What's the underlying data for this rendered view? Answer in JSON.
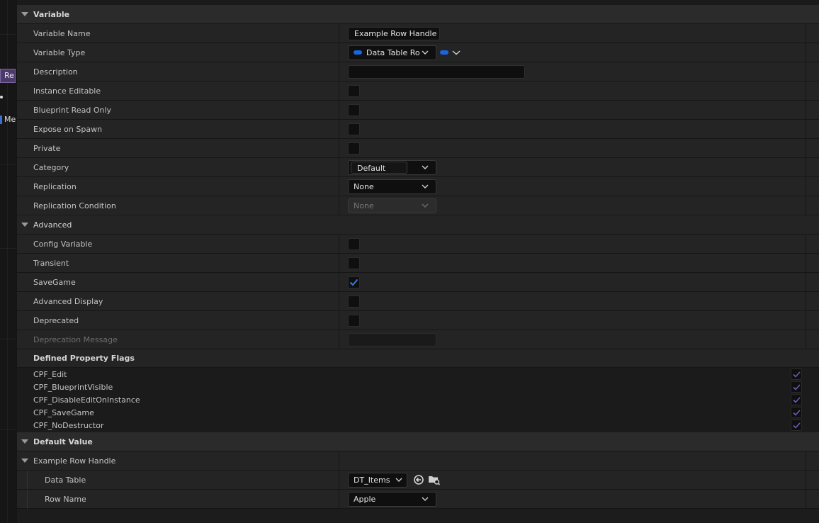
{
  "graph": {
    "node_re_label": "Re",
    "node_me_label": "Me"
  },
  "variable_section": {
    "title": "Variable",
    "variable_name": {
      "label": "Variable Name",
      "value": "Example Row Handle"
    },
    "variable_type": {
      "label": "Variable Type",
      "value": "Data Table Ro",
      "color": "#1a66e0"
    },
    "description": {
      "label": "Description",
      "value": ""
    },
    "instance_editable": {
      "label": "Instance Editable",
      "checked": false
    },
    "blueprint_read_only": {
      "label": "Blueprint Read Only",
      "checked": false
    },
    "expose_on_spawn": {
      "label": "Expose on Spawn",
      "checked": false
    },
    "private": {
      "label": "Private",
      "checked": false
    },
    "category": {
      "label": "Category",
      "value": "Default"
    },
    "replication": {
      "label": "Replication",
      "value": "None"
    },
    "replication_condition": {
      "label": "Replication Condition",
      "value": "None"
    }
  },
  "advanced_section": {
    "title": "Advanced",
    "config_variable": {
      "label": "Config Variable",
      "checked": false
    },
    "transient": {
      "label": "Transient",
      "checked": false
    },
    "save_game": {
      "label": "SaveGame",
      "checked": true
    },
    "advanced_display": {
      "label": "Advanced Display",
      "checked": false
    },
    "deprecated": {
      "label": "Deprecated",
      "checked": false
    },
    "deprecation_message": {
      "label": "Deprecation Message",
      "value": ""
    },
    "defined_flags_title": "Defined Property Flags",
    "flags": [
      {
        "label": "CPF_Edit",
        "checked": true
      },
      {
        "label": "CPF_BlueprintVisible",
        "checked": true
      },
      {
        "label": "CPF_DisableEditOnInstance",
        "checked": true
      },
      {
        "label": "CPF_SaveGame",
        "checked": true
      },
      {
        "label": "CPF_NoDestructor",
        "checked": true
      }
    ]
  },
  "default_value_section": {
    "title": "Default Value",
    "struct_label": "Example Row Handle",
    "data_table": {
      "label": "Data Table",
      "value": "DT_Items"
    },
    "row_name": {
      "label": "Row Name",
      "value": "Apple"
    }
  },
  "colors": {
    "accent_blue": "#1a66e0",
    "check_blue": "#3b7bdc",
    "flag_check": "#6a5fb8"
  }
}
